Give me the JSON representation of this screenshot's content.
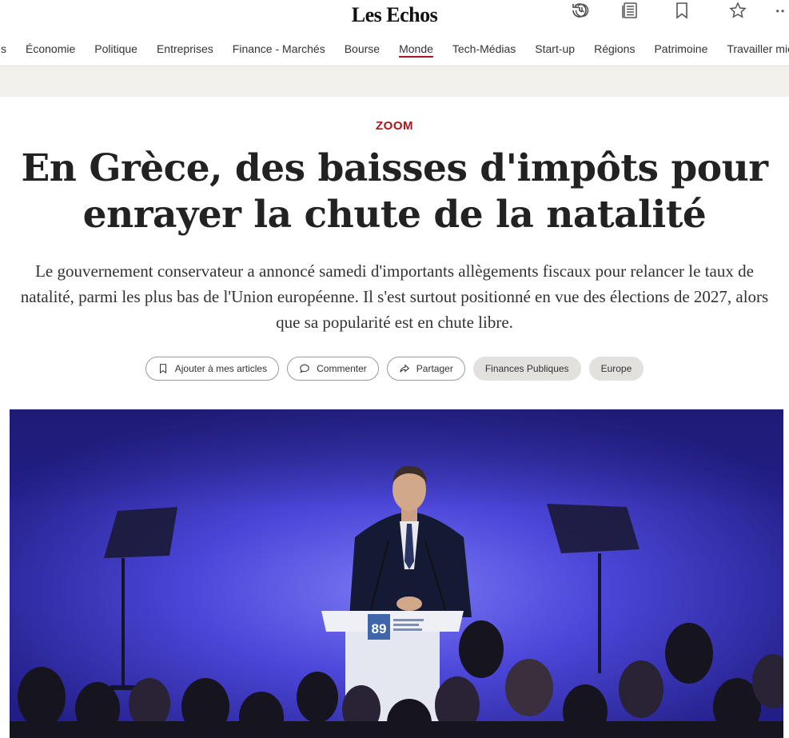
{
  "site": {
    "logo": "Les Echos"
  },
  "top_icons": [
    {
      "name": "history-icon"
    },
    {
      "name": "newspaper-icon"
    },
    {
      "name": "bookmark-icon"
    },
    {
      "name": "star-icon"
    },
    {
      "name": "more-icon"
    }
  ],
  "nav": {
    "items": [
      {
        "label": "s"
      },
      {
        "label": "Économie"
      },
      {
        "label": "Politique"
      },
      {
        "label": "Entreprises"
      },
      {
        "label": "Finance - Marchés"
      },
      {
        "label": "Bourse"
      },
      {
        "label": "Monde",
        "active": true
      },
      {
        "label": "Tech-Médias"
      },
      {
        "label": "Start-up"
      },
      {
        "label": "Régions"
      },
      {
        "label": "Patrimoine"
      },
      {
        "label": "Travailler mie"
      }
    ]
  },
  "article": {
    "kicker": "ZOOM",
    "headline": "En Grèce, des baisses d'impôts pour enrayer la chute de la natalité",
    "lede": "Le gouvernement conservateur a annoncé samedi d'importants allègements fiscaux pour relancer le taux de natalité, parmi les plus bas de l'Union européenne. Il s'est surtout positionné en vue des élections de 2027, alors que sa popularité est en chute libre."
  },
  "actions": {
    "save_label": "Ajouter à mes articles",
    "comment_label": "Commenter",
    "share_label": "Partager",
    "tags": [
      "Finances Publiques",
      "Europe"
    ]
  },
  "hero_image": {
    "podium_logo_text": "89"
  },
  "colors": {
    "accent": "#a8171c",
    "band": "#f3f1ec",
    "stage": "#3a35c0"
  }
}
